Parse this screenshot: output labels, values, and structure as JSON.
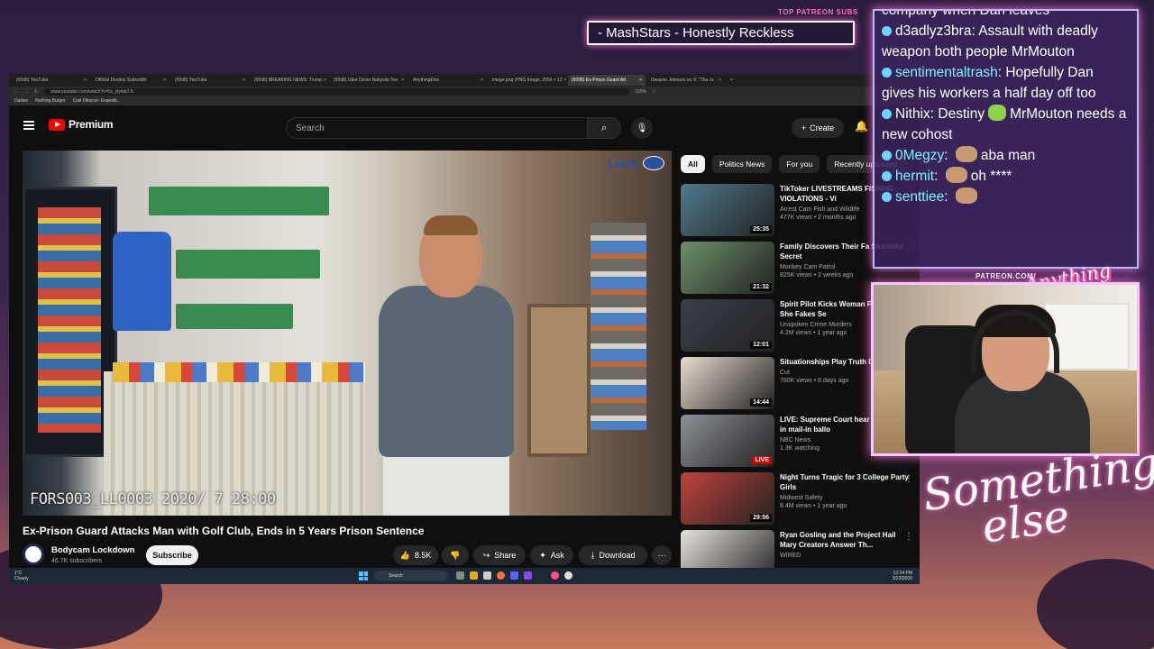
{
  "browser": {
    "tabs": [
      {
        "label": "(6098) YouTube",
        "active": false
      },
      {
        "label": "Official Destiny Subreddit",
        "active": false
      },
      {
        "label": "(6098) YouTube",
        "active": false
      },
      {
        "label": "(6098) BREAKING NEWS: Trump",
        "active": false
      },
      {
        "label": "(6098) Uber Driver Babysits Tee",
        "active": false
      },
      {
        "label": "AnythingElse",
        "active": false
      },
      {
        "label": "image.png (PNG Image, 2556 × 12",
        "active": false
      },
      {
        "label": "(6098) Ex-Prison Guard Att",
        "active": true
      },
      {
        "label": "Dwayne Johnson on X: \"Tha cs",
        "active": false
      }
    ],
    "url": "www.youtube.com/watch?v=5e_ylymk7Jc",
    "zoom": "160%",
    "bookmarks": [
      "Dailies",
      "Nothing Burger",
      "Ciali Obscue: Expediti..."
    ]
  },
  "youtube": {
    "logo_text": "Premium",
    "search_placeholder": "Search",
    "create_label": "Create",
    "notification_count": "9+",
    "video": {
      "title": "Ex-Prison Guard Attacks Man with Golf Club, Ends in 5 Years Prison Sentence",
      "channel": "Bodycam Lockdown",
      "subscribers": "46.7K subscribers",
      "subscribe_label": "Subscribe",
      "likes": "8.5K",
      "share_label": "Share",
      "ask_label": "Ask",
      "download_label": "Download",
      "overlay_brand": "Lock",
      "camera_timestamp": "FORS003_LL0003 2020/ 7  28:00"
    },
    "chips": [
      {
        "label": "All",
        "active": true
      },
      {
        "label": "Politics News",
        "active": false
      },
      {
        "label": "For you",
        "active": false
      },
      {
        "label": "Recently uploaded",
        "active": false
      }
    ],
    "recommendations": [
      {
        "title": "TikToker LIVESTREAMS FISHING VIOLATIONS - Vi",
        "channel": "Arrest Cam Fish and Wildlife",
        "meta": "477K views • 2 months ago",
        "duration": "25:35",
        "thumb_color": "#4f7a8c"
      },
      {
        "title": "Family Discovers Their Fa Shameful Secret",
        "channel": "Monkey Cam Patrol",
        "meta": "825K views • 2 weeks ago",
        "duration": "21:32",
        "thumb_color": "#6d8f6a"
      },
      {
        "title": "Spirit Pilot Kicks Woman Plane After She Fakes Se",
        "channel": "Unspoken Crime Murders",
        "meta": "4.2M views • 1 year ago",
        "duration": "12:01",
        "thumb_color": "#3a3f4a"
      },
      {
        "title": "Situationships Play Truth Drink | Cut",
        "channel": "Cut",
        "meta": "760K views • 8 days ago",
        "duration": "14:44",
        "thumb_color": "#e9dcd0"
      },
      {
        "title": "LIVE: Supreme Court hear arguments in mail-in ballo",
        "channel": "NBC News",
        "meta": "1.3K watching",
        "duration": "LIVE",
        "thumb_color": "#8c8f96"
      },
      {
        "title": "Night Turns Tragic for 3 College Party Girls",
        "channel": "Midwest Safety",
        "meta": "8.4M views • 1 year ago",
        "duration": "29:56",
        "thumb_color": "#c0423a"
      },
      {
        "title": "Ryan Gosling and the Project Hail Mary Creators Answer Th...",
        "channel": "WIRED",
        "meta": "",
        "duration": "",
        "thumb_color": "#e7e2dc"
      }
    ]
  },
  "taskbar": {
    "weather_temp": "1°C",
    "weather_desc": "Cloudy",
    "search_placeholder": "Search",
    "time": "12:24 PM",
    "date": "3/23/2026"
  },
  "stream": {
    "patreon_label": "TOP PATREON SUBS",
    "ticker_text": "- MashStars - Honestly Reckless",
    "patreon_url": "PATREON.COM/",
    "anything_logo": "Anything Else",
    "something_else_1": "Something",
    "something_else_2": "else",
    "chat": [
      {
        "user": "",
        "message": "company when Dan leaves",
        "partial": true
      },
      {
        "user": "d3adlyz3bra",
        "message": "Assault with deadly weapon both people MrMouton",
        "user_color": "white"
      },
      {
        "user": "sentimentaltrash",
        "message": "Hopefully Dan gives his workers a half day off too",
        "user_color": "cyan"
      },
      {
        "user": "Nithix",
        "message": "Destiny",
        "after_emote": "MrMouton needs a new cohost",
        "emote": "green",
        "user_color": "white"
      },
      {
        "user": "0Megzy",
        "message": "",
        "after_emote": "aba man",
        "emote": "face",
        "user_color": "cyan"
      },
      {
        "user": "hermit",
        "message": "",
        "after_emote": "oh ****",
        "emote": "face",
        "user_color": "cyan"
      },
      {
        "user": "senttiee",
        "message": "",
        "after_emote": "",
        "emote": "face",
        "user_color": "cyan"
      }
    ]
  }
}
